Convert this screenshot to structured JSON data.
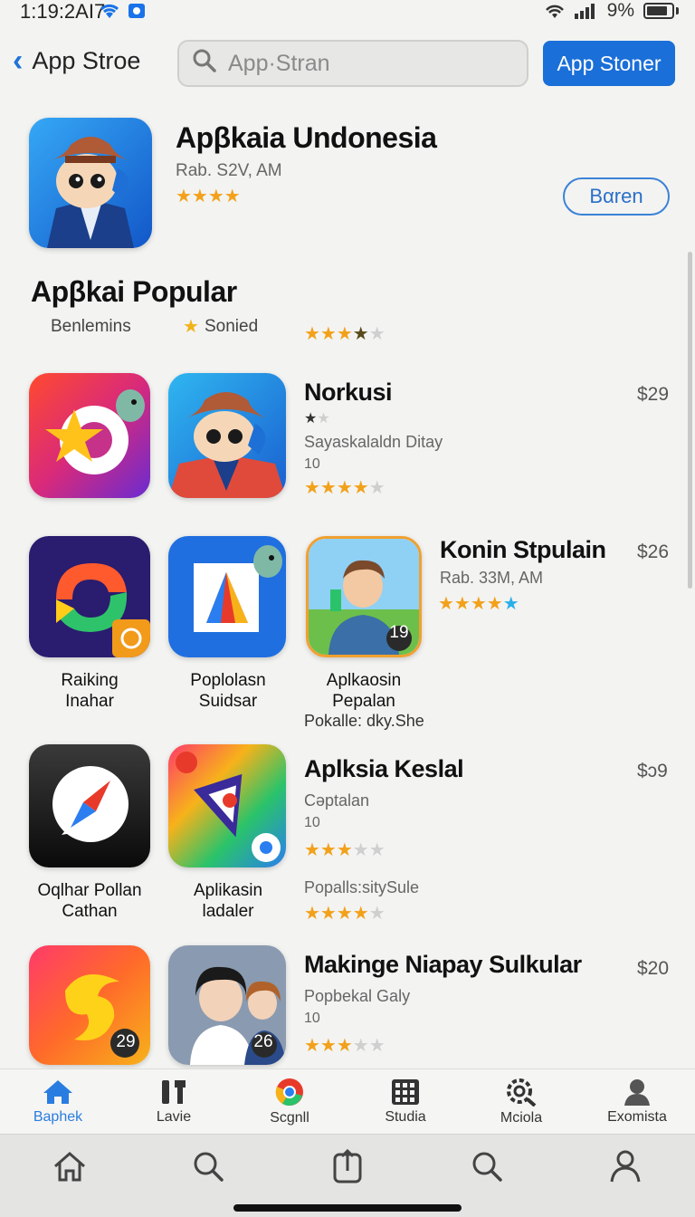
{
  "status": {
    "time": "1:19:2AI7",
    "battery": "9%"
  },
  "header": {
    "back_label": "App Stroe",
    "search_placeholder": "App·Stran",
    "store_button": "App Stoner"
  },
  "featured": {
    "title": "Apβkaia Undonesia",
    "meta": "Rab. S2V, AM",
    "open_button": "Bαren",
    "rating": 4
  },
  "section": {
    "title": "Apβkai Popular",
    "col1": "Benlemins",
    "col2": "Sonied",
    "rating": 3.5
  },
  "rows": [
    {
      "title": "Norkusi",
      "price": "$29",
      "small_rating": 1.5,
      "desc": "Sayaskalaldn Ditay",
      "count": "10",
      "rating": 4
    },
    {
      "title": "Konin Stpulain",
      "price": "$26",
      "meta": "Rab. 33M, AM",
      "rating": 5
    },
    {
      "title": "Aplksia Keslal",
      "price": "$ɔ9",
      "desc": "Cəptalan",
      "count": "10",
      "rating": 3,
      "desc2": "Popalls:sitySule",
      "rating2": 4
    },
    {
      "title": "Makinge Niapay Sulkular",
      "price": "$20",
      "desc": "Popbekal Galy",
      "count": "10",
      "rating": 3
    }
  ],
  "captions": {
    "raiking": [
      "Raiking",
      "Inahar"
    ],
    "poplolasn": [
      "Poplolasn",
      "Suidsar"
    ],
    "aplkaosin": [
      "Aplkaosin",
      "Pepalan"
    ],
    "aplkaosin_sub": "Pokalle: dky.She",
    "oqlhar": [
      "Oqlhar Pollan",
      "Cathan"
    ],
    "aplikasin": [
      "Aplikasin",
      "ladaler"
    ]
  },
  "badges": {
    "kid": "19",
    "icon29": "29",
    "girls": "26"
  },
  "tabs": [
    {
      "label": "Baphek",
      "icon": "home-icon",
      "active": true
    },
    {
      "label": "Lavie",
      "icon": "tools-icon"
    },
    {
      "label": "Scgnll",
      "icon": "chrome-icon"
    },
    {
      "label": "Studia",
      "icon": "grid-icon"
    },
    {
      "label": "Mciola",
      "icon": "gear-search-icon"
    },
    {
      "label": "Exomista",
      "icon": "person-icon"
    }
  ],
  "nav": [
    "home-outline-icon",
    "search-icon",
    "share-icon",
    "search-icon",
    "profile-icon"
  ],
  "colors": {
    "accent": "#1a6fd8",
    "star": "#f2a11a"
  }
}
